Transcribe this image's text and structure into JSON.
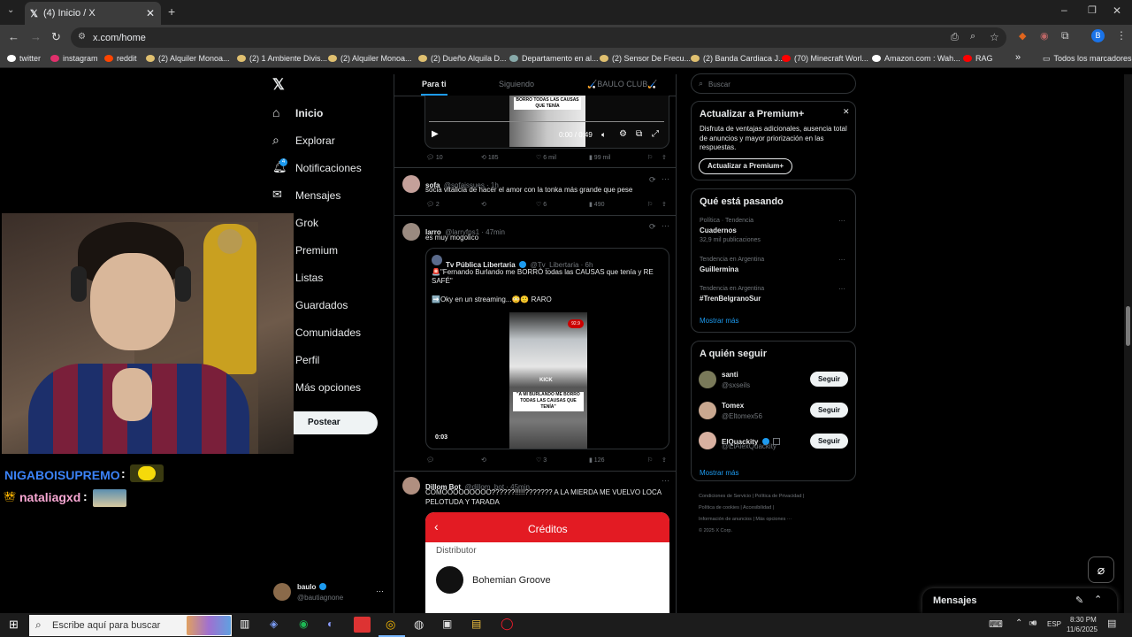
{
  "browser": {
    "tab_title": "(4) Inicio / X",
    "url": "x.com/home",
    "profile_initial": "B",
    "bookmarks": [
      {
        "label": "twitter",
        "color": "#fff"
      },
      {
        "label": "instagram",
        "color": "#e1306c"
      },
      {
        "label": "reddit",
        "color": "#ff4500"
      },
      {
        "label": "(2) Alquiler Monoa...",
        "color": "#e0c070"
      },
      {
        "label": "(2) 1 Ambiente Divis...",
        "color": "#e0c070"
      },
      {
        "label": "(2) Alquiler Monoa...",
        "color": "#e0c070"
      },
      {
        "label": "(2) Dueño Alquila D...",
        "color": "#e0c070"
      },
      {
        "label": "Departamento en al...",
        "color": "#8aa"
      },
      {
        "label": "(2) Sensor De Frecu...",
        "color": "#e0c070"
      },
      {
        "label": "(2) Banda Cardiaca J...",
        "color": "#e0c070"
      },
      {
        "label": "(70) Minecraft Worl...",
        "color": "#ff0000"
      },
      {
        "label": "Amazon.com : Wah...",
        "color": "#fff"
      },
      {
        "label": "RAG",
        "color": "#ff0000"
      }
    ],
    "bookmarks_overflow": "»",
    "all_bookmarks": "Todos los marcadores"
  },
  "nav": {
    "items": [
      "Inicio",
      "Explorar",
      "Notificaciones",
      "Mensajes",
      "Grok",
      "Premium",
      "Listas",
      "Guardados",
      "Comunidades",
      "Perfil",
      "Más opciones"
    ],
    "post_button": "Postear",
    "notif_badge": "4",
    "account_name": "baulo",
    "account_handle": "@bautiagnone"
  },
  "stream_chat": [
    {
      "user": "NIGABOISUPREMO",
      "color": "#3b82f6"
    },
    {
      "user": "nataliagxd",
      "color": "#f9a8d4"
    }
  ],
  "timeline": {
    "tabs": [
      "Para ti",
      "Siguiendo",
      "🏑BAULO CLUB🏑"
    ],
    "video1": {
      "time": "0:00 / 0:49",
      "overlay": "BORRO TODAS LAS CAUSAS QUE TENÍA"
    },
    "video1_actions": {
      "replies": "10",
      "reposts": "185",
      "likes": "6 mil",
      "views": "99 mil"
    },
    "posts": [
      {
        "name": "sofa",
        "handle": "@sofaissues · 1h",
        "text": "socia vitalicia de hacer el amor con la tonka más grande que pese",
        "replies": "2",
        "reposts": "",
        "likes": "6",
        "views": "490"
      },
      {
        "name": "larro",
        "handle": "@larryfps1 · 47min",
        "text": "es muy mogolico",
        "replies": "",
        "reposts": "",
        "likes": "3",
        "views": "126"
      },
      {
        "name": "Dillom Bot",
        "handle": "@dillom_bot · 45min",
        "text": "COMOOOOOOOOO??????!!!!!??????? A LA MIERDA ME VUELVO LOCA PELOTUDA Y TARADA"
      }
    ],
    "quote": {
      "name": "Tv Pública Libertaria",
      "handle": "@Tv_Libertaria · 6h",
      "line1": "🚨\"Fernando Burlando me BORRÓ todas las CAUSAS que tenía y RE SAFÉ\"",
      "line2": "➡️Oky en un streaming...😳🙂 RARO",
      "video_time": "0:03",
      "video_overlay": "\"A MI BURLANDO ME BORRO TODAS LAS CAUSAS QUE TENÍA\"",
      "video_top": "KICK",
      "video_badge": "92.9"
    },
    "credits": {
      "title": "Créditos",
      "label": "Distributor",
      "company": "Bohemian Groove"
    }
  },
  "right": {
    "search_placeholder": "Buscar",
    "premium": {
      "title": "Actualizar a Premium+",
      "body": "Disfruta de ventajas adicionales, ausencia total de anuncios y mayor priorización en las respuestas.",
      "button": "Actualizar a Premium+"
    },
    "trending": {
      "title": "Qué está pasando",
      "items": [
        {
          "context": "Política · Tendencia",
          "name": "Cuadernos",
          "count": "32,9 mil publicaciones"
        },
        {
          "context": "Tendencia en Argentina",
          "name": "Guillermina",
          "count": ""
        },
        {
          "context": "Tendencia en Argentina",
          "name": "#TrenBelgranoSur",
          "count": ""
        }
      ],
      "more": "Mostrar más"
    },
    "follow": {
      "title": "A quién seguir",
      "items": [
        {
          "name": "santi",
          "handle": "@sxseils",
          "button": "Seguir"
        },
        {
          "name": "Tomex",
          "handle": "@Eltomex56",
          "button": "Seguir"
        },
        {
          "name": "ElQuackity",
          "handle": "@ElAlexQuackity",
          "button": "Seguir"
        }
      ],
      "more": "Mostrar más"
    },
    "footer": {
      "line1": "Condiciones de Servicio | Política de Privacidad |",
      "line2": "Política de cookies | Accesibilidad |",
      "line3": "Información de anuncios | Más opciones ···",
      "line4": "© 2025 X Corp."
    },
    "messages": "Mensajes"
  },
  "taskbar": {
    "search_placeholder": "Escribe aquí para buscar",
    "lang": "ESP",
    "time": "8:30 PM",
    "date": "11/6/2025"
  }
}
